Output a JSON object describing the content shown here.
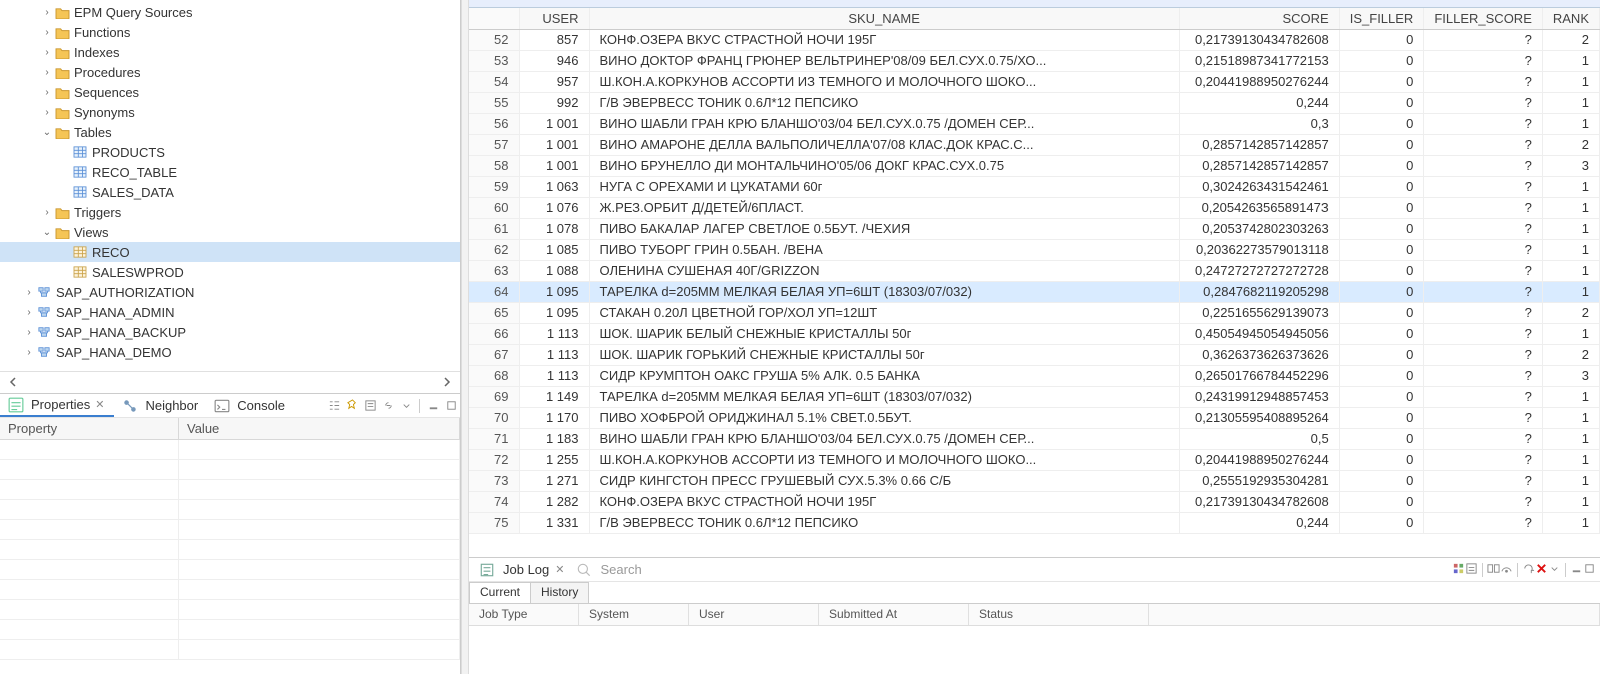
{
  "tree": {
    "items": [
      {
        "indent": 2,
        "twisty": ">",
        "iconType": "folder",
        "label": "EPM Query Sources"
      },
      {
        "indent": 2,
        "twisty": ">",
        "iconType": "folder",
        "label": "Functions"
      },
      {
        "indent": 2,
        "twisty": ">",
        "iconType": "folder",
        "label": "Indexes"
      },
      {
        "indent": 2,
        "twisty": ">",
        "iconType": "folder",
        "label": "Procedures"
      },
      {
        "indent": 2,
        "twisty": ">",
        "iconType": "folder",
        "label": "Sequences"
      },
      {
        "indent": 2,
        "twisty": ">",
        "iconType": "folder",
        "label": "Synonyms"
      },
      {
        "indent": 2,
        "twisty": "v",
        "iconType": "folder",
        "label": "Tables"
      },
      {
        "indent": 3,
        "twisty": "",
        "iconType": "table",
        "label": "PRODUCTS"
      },
      {
        "indent": 3,
        "twisty": "",
        "iconType": "table",
        "label": "RECO_TABLE"
      },
      {
        "indent": 3,
        "twisty": "",
        "iconType": "table",
        "label": "SALES_DATA"
      },
      {
        "indent": 2,
        "twisty": ">",
        "iconType": "folder",
        "label": "Triggers"
      },
      {
        "indent": 2,
        "twisty": "v",
        "iconType": "folder",
        "label": "Views"
      },
      {
        "indent": 3,
        "twisty": "",
        "iconType": "view",
        "label": "RECO",
        "selected": true
      },
      {
        "indent": 3,
        "twisty": "",
        "iconType": "view",
        "label": "SALESWPROD"
      },
      {
        "indent": 1,
        "twisty": ">",
        "iconType": "schema",
        "label": "SAP_AUTHORIZATION"
      },
      {
        "indent": 1,
        "twisty": ">",
        "iconType": "schema",
        "label": "SAP_HANA_ADMIN"
      },
      {
        "indent": 1,
        "twisty": ">",
        "iconType": "schema",
        "label": "SAP_HANA_BACKUP"
      },
      {
        "indent": 1,
        "twisty": ">",
        "iconType": "schema",
        "label": "SAP_HANA_DEMO"
      }
    ]
  },
  "properties": {
    "tabs": {
      "properties": "Properties",
      "neighbor": "Neighbor",
      "console": "Console"
    },
    "columns": {
      "property": "Property",
      "value": "Value"
    }
  },
  "table": {
    "columns": [
      "",
      "USER",
      "SKU_NAME",
      "SCORE",
      "IS_FILLER",
      "FILLER_SCORE",
      "RANK"
    ],
    "selectedRow": 64,
    "rows": [
      {
        "n": 52,
        "user": "857",
        "sku": "КОНФ.ОЗЕРА ВКУС СТРАСТНОЙ НОЧИ 195Г",
        "score": "0,21739130434782608",
        "is_filler": "0",
        "filler_score": "?",
        "rank": "2"
      },
      {
        "n": 53,
        "user": "946",
        "sku": "ВИНО ДОКТОР ФРАНЦ ГРЮНЕР ВЕЛЬТРИНЕР'08/09 БЕЛ.СУХ.0.75/ХО...",
        "score": "0,21518987341772153",
        "is_filler": "0",
        "filler_score": "?",
        "rank": "1"
      },
      {
        "n": 54,
        "user": "957",
        "sku": "Ш.КОН.А.КОРКУНОВ АССОРТИ ИЗ ТЕМНОГО И МОЛОЧНОГО ШОКО...",
        "score": "0,20441988950276244",
        "is_filler": "0",
        "filler_score": "?",
        "rank": "1"
      },
      {
        "n": 55,
        "user": "992",
        "sku": "Г/В ЭВЕРВЕСС ТОНИК 0.6Л*12 ПЕПСИКО",
        "score": "0,244",
        "is_filler": "0",
        "filler_score": "?",
        "rank": "1"
      },
      {
        "n": 56,
        "user": "1 001",
        "sku": "ВИНО ШАБЛИ ГРАН КРЮ БЛАНШО'03/04 БЕЛ.СУХ.0.75 /ДОМЕН СЕР...",
        "score": "0,3",
        "is_filler": "0",
        "filler_score": "?",
        "rank": "1"
      },
      {
        "n": 57,
        "user": "1 001",
        "sku": "ВИНО АМАРОНЕ ДЕЛЛА ВАЛЬПОЛИЧЕЛЛА'07/08 КЛАС.ДОК КРАС.С...",
        "score": "0,2857142857142857",
        "is_filler": "0",
        "filler_score": "?",
        "rank": "2"
      },
      {
        "n": 58,
        "user": "1 001",
        "sku": "ВИНО БРУНЕЛЛО ДИ МОНТАЛЬЧИНО'05/06 ДОКГ КРАС.СУХ.0.75",
        "score": "0,2857142857142857",
        "is_filler": "0",
        "filler_score": "?",
        "rank": "3"
      },
      {
        "n": 59,
        "user": "1 063",
        "sku": "НУГА С ОРЕХАМИ И ЦУКАТАМИ 60г",
        "score": "0,3024263431542461",
        "is_filler": "0",
        "filler_score": "?",
        "rank": "1"
      },
      {
        "n": 60,
        "user": "1 076",
        "sku": "Ж.РЕЗ.ОРБИТ Д/ДЕТЕЙ/6ПЛАСТ.",
        "score": "0,205426356589147З",
        "is_filler": "0",
        "filler_score": "?",
        "rank": "1"
      },
      {
        "n": 61,
        "user": "1 078",
        "sku": "ПИВО БАКАЛАР ЛАГЕР СВЕТЛОЕ 0.5БУТ. /ЧЕХИЯ",
        "score": "0,2053742802303263",
        "is_filler": "0",
        "filler_score": "?",
        "rank": "1"
      },
      {
        "n": 62,
        "user": "1 085",
        "sku": "ПИВО ТУБОРГ ГРИН 0.5БАН. /ВЕНА",
        "score": "0,20362273579013118",
        "is_filler": "0",
        "filler_score": "?",
        "rank": "1"
      },
      {
        "n": 63,
        "user": "1 088",
        "sku": "ОЛЕНИНА СУШЕНАЯ 40Г/GRIZZON",
        "score": "0,24727272727272728",
        "is_filler": "0",
        "filler_score": "?",
        "rank": "1"
      },
      {
        "n": 64,
        "user": "1 095",
        "sku": "ТАРЕЛКА d=205ММ МЕЛКАЯ БЕЛАЯ УП=6ШТ (18303/07/032)",
        "score": "0,2847682119205298",
        "is_filler": "0",
        "filler_score": "?",
        "rank": "1"
      },
      {
        "n": 65,
        "user": "1 095",
        "sku": "СТАКАН 0.20Л ЦВЕТНОЙ ГОР/ХОЛ УП=12ШТ",
        "score": "0,2251655629139073",
        "is_filler": "0",
        "filler_score": "?",
        "rank": "2"
      },
      {
        "n": 66,
        "user": "1 113",
        "sku": "ШОК. ШАРИК БЕЛЫЙ СНЕЖНЫЕ КРИСТАЛЛЫ 50г",
        "score": "0,45054945054945056",
        "is_filler": "0",
        "filler_score": "?",
        "rank": "1"
      },
      {
        "n": 67,
        "user": "1 113",
        "sku": "ШОК. ШАРИК ГОРЬКИЙ СНЕЖНЫЕ КРИСТАЛЛЫ 50г",
        "score": "0,3626373626373626",
        "is_filler": "0",
        "filler_score": "?",
        "rank": "2"
      },
      {
        "n": 68,
        "user": "1 113",
        "sku": "СИДР КРУМПТОН ОАКС ГРУША 5% АЛК. 0.5 БАНКА",
        "score": "0,26501766784452296",
        "is_filler": "0",
        "filler_score": "?",
        "rank": "3"
      },
      {
        "n": 69,
        "user": "1 149",
        "sku": "ТАРЕЛКА d=205ММ МЕЛКАЯ БЕЛАЯ УП=6ШТ (18303/07/032)",
        "score": "0,24319912948857453",
        "is_filler": "0",
        "filler_score": "?",
        "rank": "1"
      },
      {
        "n": 70,
        "user": "1 170",
        "sku": "ПИВО ХОФБРОЙ ОРИДЖИНАЛ 5.1% СВЕТ.0.5БУТ.",
        "score": "0,21305595408895264",
        "is_filler": "0",
        "filler_score": "?",
        "rank": "1"
      },
      {
        "n": 71,
        "user": "1 183",
        "sku": "ВИНО ШАБЛИ ГРАН КРЮ БЛАНШО'03/04 БЕЛ.СУХ.0.75 /ДОМЕН СЕР...",
        "score": "0,5",
        "is_filler": "0",
        "filler_score": "?",
        "rank": "1"
      },
      {
        "n": 72,
        "user": "1 255",
        "sku": "Ш.КОН.А.КОРКУНОВ АССОРТИ ИЗ ТЕМНОГО И МОЛОЧНОГО ШОКО...",
        "score": "0,20441988950276244",
        "is_filler": "0",
        "filler_score": "?",
        "rank": "1"
      },
      {
        "n": 73,
        "user": "1 271",
        "sku": "СИДР КИНГСТОН ПРЕСС ГРУШЕВЫЙ СУХ.5.3% 0.66 С/Б",
        "score": "0,2555192935304281",
        "is_filler": "0",
        "filler_score": "?",
        "rank": "1"
      },
      {
        "n": 74,
        "user": "1 282",
        "sku": "КОНФ.ОЗЕРА ВКУС СТРАСТНОЙ НОЧИ 195Г",
        "score": "0,21739130434782608",
        "is_filler": "0",
        "filler_score": "?",
        "rank": "1"
      },
      {
        "n": 75,
        "user": "1 331",
        "sku": "Г/В ЭВЕРВЕСС ТОНИК 0.6Л*12 ПЕПСИКО",
        "score": "0,244",
        "is_filler": "0",
        "filler_score": "?",
        "rank": "1"
      }
    ]
  },
  "joblog": {
    "tab_label": "Job Log",
    "search_placeholder": "Search",
    "subtabs": {
      "current": "Current",
      "history": "History"
    },
    "columns": [
      "Job Type",
      "System",
      "User",
      "Submitted At",
      "Status"
    ]
  }
}
